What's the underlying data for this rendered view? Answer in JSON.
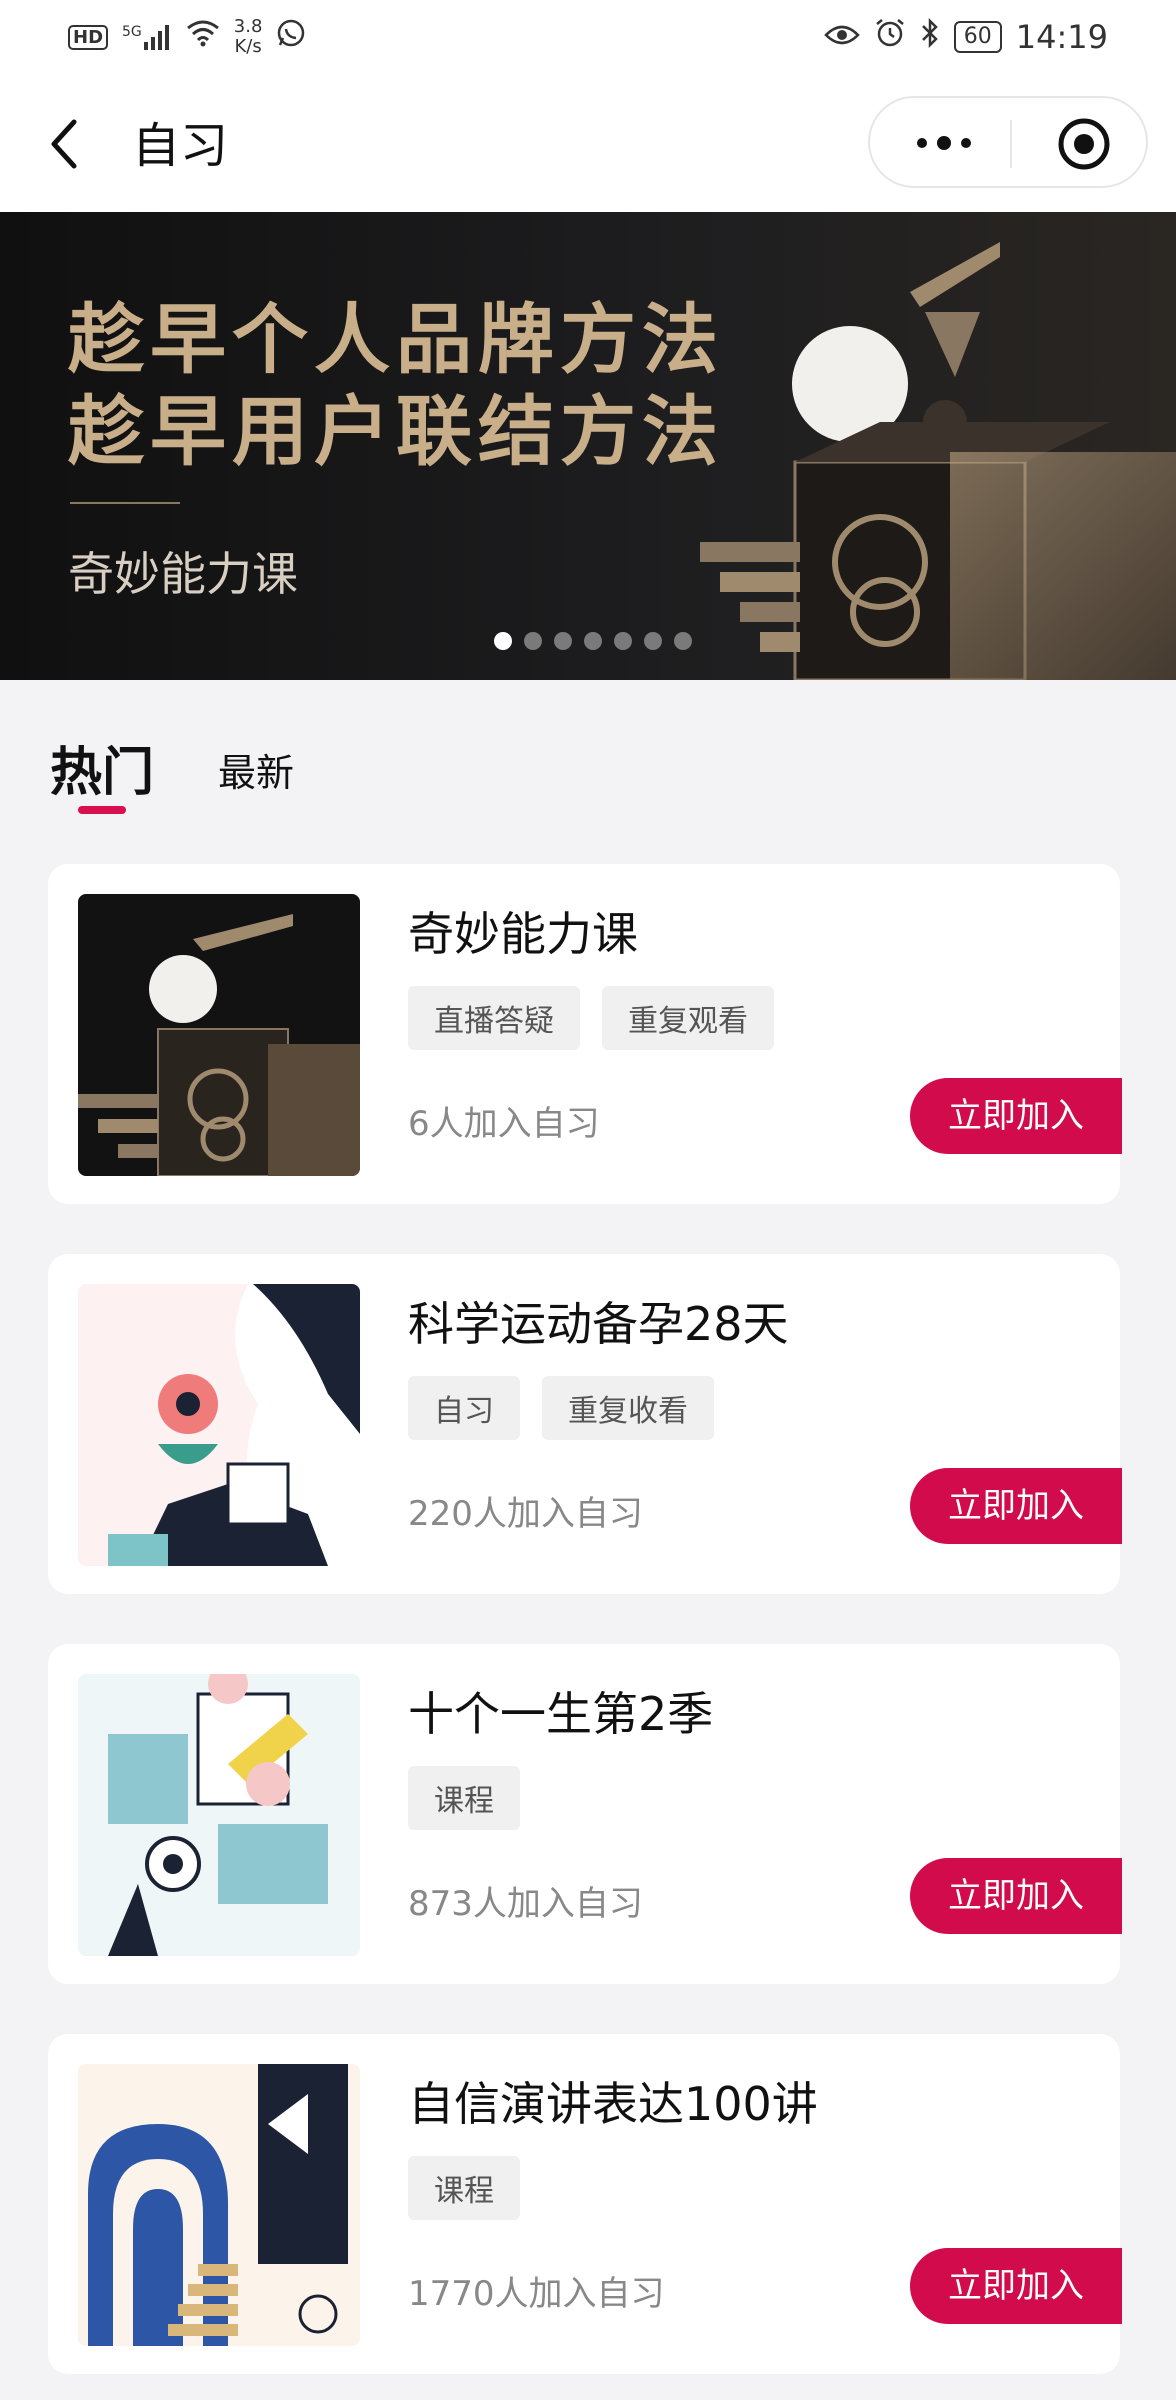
{
  "status_bar": {
    "hd": "HD",
    "network": "5G",
    "speed_value": "3.8",
    "speed_unit": "K/s",
    "battery": "60",
    "time": "14:19"
  },
  "nav": {
    "title": "自习"
  },
  "banner": {
    "headline_line1": "趁早个人品牌方法",
    "headline_line2": "趁早用户联结方法",
    "subtitle": "奇妙能力课",
    "slide_count": 7,
    "active_slide": 1
  },
  "tabs": [
    {
      "label": "热门",
      "active": true
    },
    {
      "label": "最新",
      "active": false
    }
  ],
  "courses": [
    {
      "title": "奇妙能力课",
      "tags": [
        "直播答疑",
        "重复观看"
      ],
      "count": "6人加入自习",
      "button": "立即加入"
    },
    {
      "title": "科学运动备孕28天",
      "tags": [
        "自习",
        "重复收看"
      ],
      "count": "220人加入自习",
      "button": "立即加入"
    },
    {
      "title": "十个一生第2季",
      "tags": [
        "课程"
      ],
      "count": "873人加入自习",
      "button": "立即加入"
    },
    {
      "title": "自信演讲表达100讲",
      "tags": [
        "课程"
      ],
      "count": "1770人加入自习",
      "button": "立即加入"
    }
  ],
  "colors": {
    "accent": "#d20b4d",
    "banner_gold": "#c9ae8a"
  }
}
